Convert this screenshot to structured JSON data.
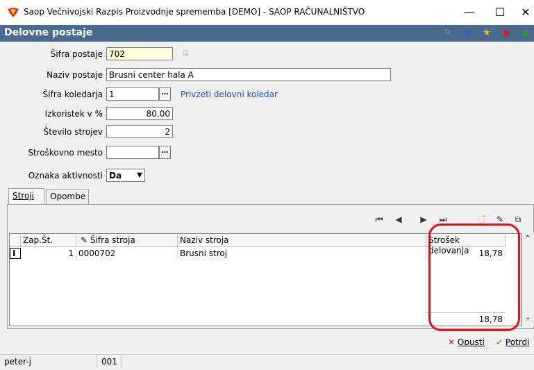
{
  "window": {
    "title": "Saop  Večnivojski Razpis Proizvodnje sprememba [DEMO] - SAOP RAČUNALNIŠTVO",
    "minimize_glyph": "—",
    "maximize_glyph": "☐",
    "close_glyph": "✕"
  },
  "module": {
    "title": "Delovne postaje",
    "toolbar_icons": [
      "edit-icon",
      "table-icon",
      "star-icon",
      "pdf-icon",
      "exit-icon"
    ]
  },
  "form": {
    "sifra_postaje": {
      "label": "Šifra postaje",
      "value": "702"
    },
    "naziv_postaje": {
      "label": "Naziv postaje",
      "value": "Brusni center hala A"
    },
    "sifra_koledarja": {
      "label": "Šifra koledarja",
      "value": "1",
      "link": "Privzeti delovni koledar"
    },
    "izkoristek": {
      "label": "Izkoristek v %",
      "value": "80,00"
    },
    "stevilo_strojev": {
      "label": "Število strojev",
      "value": "2"
    },
    "stroskovno_mesto": {
      "label": "Stroškovno mesto",
      "value": ""
    },
    "oznaka_aktivnosti": {
      "label": "Oznaka aktivnosti",
      "value": "Da"
    }
  },
  "tabs": [
    {
      "label": "Stroji"
    },
    {
      "label": "Opombe"
    }
  ],
  "grid": {
    "columns": [
      "Zap.Št.",
      "Šifra stroja",
      "Naziv stroja",
      "Strošek delovanja"
    ],
    "rows": [
      {
        "zap": "1",
        "sifra": "0000702",
        "naziv": "Brusni stroj",
        "strosek": "18,78"
      }
    ],
    "total": "18,78",
    "row_marker": "I"
  },
  "footer": {
    "cancel_label": "Opusti",
    "confirm_label": "Potrdi"
  },
  "statusbar": {
    "user": "peter-j",
    "code": "001"
  },
  "colors": {
    "header_bg": "#4a6a8e",
    "highlight": "#e01020",
    "link": "#1a4fb5"
  }
}
